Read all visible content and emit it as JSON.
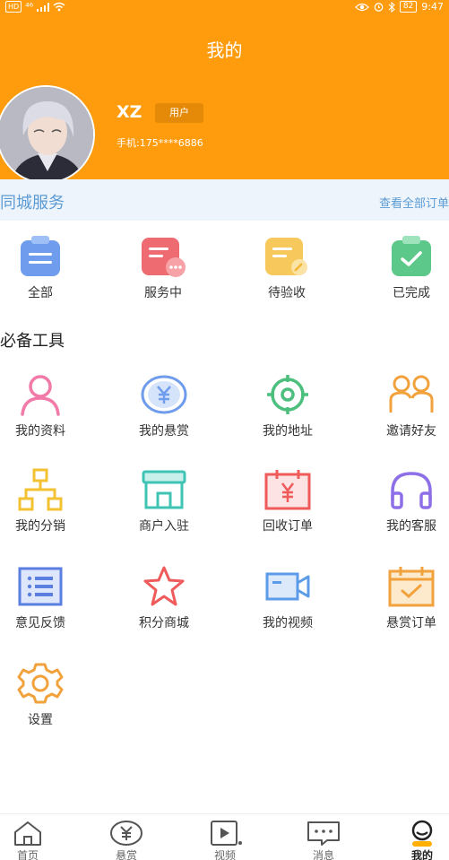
{
  "status_bar": {
    "hd": "HD",
    "network": "⁴⁶",
    "battery": "82",
    "time": "9:47"
  },
  "header": {
    "title": "我的",
    "username": "XZ",
    "user_tag": "用户",
    "phone": "手机:175****6886"
  },
  "colors": {
    "brand": "#ff9c0e",
    "link": "#5b9bd5"
  },
  "service": {
    "title": "同城服务",
    "view_all": "查看全部订单",
    "items": [
      {
        "label": "全部",
        "icon": "clipboard-list-icon"
      },
      {
        "label": "服务中",
        "icon": "document-dots-icon"
      },
      {
        "label": "待验收",
        "icon": "document-pen-icon"
      },
      {
        "label": "已完成",
        "icon": "clipboard-check-icon"
      }
    ]
  },
  "tools": {
    "title": "必备工具",
    "items": [
      {
        "label": "我的资料",
        "icon": "person-icon"
      },
      {
        "label": "我的悬赏",
        "icon": "yen-coin-icon"
      },
      {
        "label": "我的地址",
        "icon": "target-location-icon"
      },
      {
        "label": "邀请好友",
        "icon": "two-people-icon"
      },
      {
        "label": "我的分销",
        "icon": "org-chart-icon"
      },
      {
        "label": "商户入驻",
        "icon": "storefront-icon"
      },
      {
        "label": "回收订单",
        "icon": "calendar-yen-icon"
      },
      {
        "label": "我的客服",
        "icon": "headset-icon"
      },
      {
        "label": "意见反馈",
        "icon": "list-icon"
      },
      {
        "label": "积分商城",
        "icon": "star-icon"
      },
      {
        "label": "我的视频",
        "icon": "video-camera-icon"
      },
      {
        "label": "悬赏订单",
        "icon": "calendar-check-icon"
      },
      {
        "label": "设置",
        "icon": "gear-icon"
      }
    ]
  },
  "tabbar": [
    {
      "label": "首页",
      "icon": "home-icon"
    },
    {
      "label": "悬赏",
      "icon": "yen-icon"
    },
    {
      "label": "视频",
      "icon": "play-icon"
    },
    {
      "label": "消息",
      "icon": "message-icon"
    },
    {
      "label": "我的",
      "icon": "profile-icon",
      "active": true
    }
  ]
}
